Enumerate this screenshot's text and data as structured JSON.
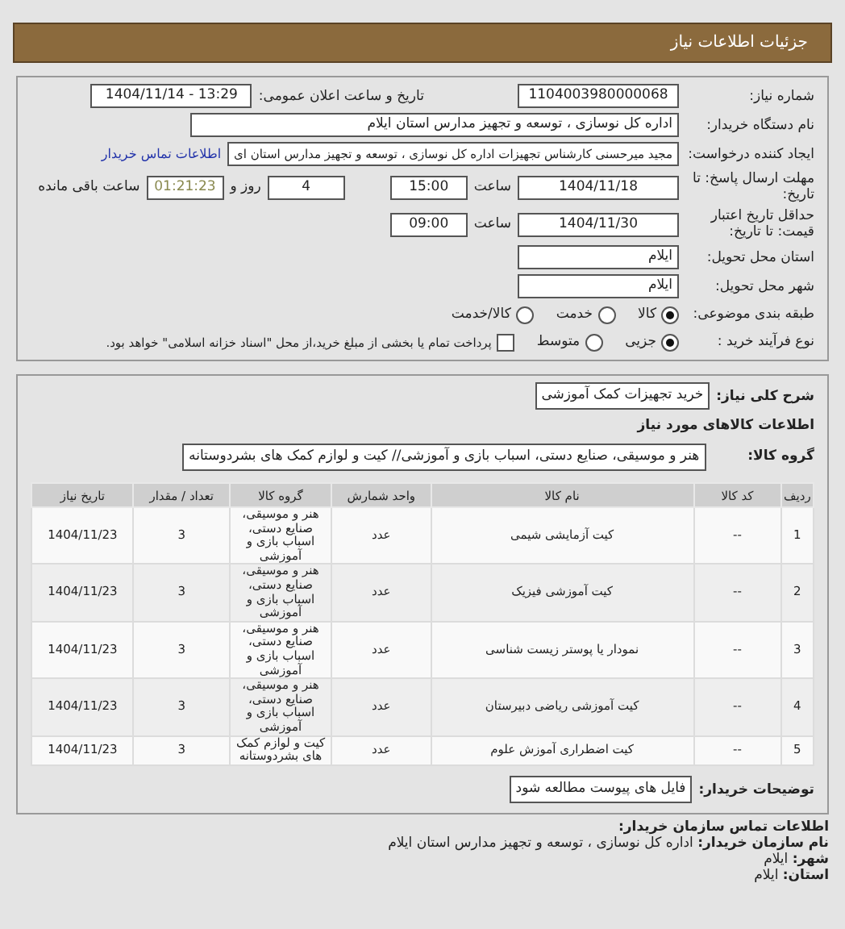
{
  "header": {
    "title": "جزئیات اطلاعات نیاز"
  },
  "details": {
    "need_number_label": "شماره نیاز:",
    "need_number": "1104003980000068",
    "announce_label": "تاریخ و ساعت اعلان عمومی:",
    "announce_value": "1404/11/14 - 13:29",
    "buyer_label": "نام دستگاه خریدار:",
    "buyer": "اداره کل نوسازی ، توسعه و تجهیز مدارس استان ایلام",
    "requester_label": "ایجاد کننده درخواست:",
    "requester": "مجید میرحسنی کارشناس تجهیزات اداره کل نوسازی ، توسعه و تجهیز مدارس استان ای",
    "contact_link": "اطلاعات تماس خریدار",
    "deadline_label": "مهلت ارسال پاسخ: تا تاریخ:",
    "deadline_date": "1404/11/18",
    "time_label": "ساعت",
    "deadline_time": "15:00",
    "days": "4",
    "days_label": "روز و",
    "remaining": "01:21:23",
    "remaining_label": "ساعت باقی مانده",
    "validity_label": "حداقل تاریخ اعتبار قیمت: تا تاریخ:",
    "validity_date": "1404/11/30",
    "validity_time_label": "ساعت",
    "validity_time": "09:00",
    "province_label": "استان محل تحویل:",
    "province": "ایلام",
    "city_label": "شهر محل تحویل:",
    "city": "ایلام",
    "category_label": "طبقه بندی موضوعی:",
    "categories": [
      {
        "label": "کالا",
        "selected": true
      },
      {
        "label": "خدمت",
        "selected": false
      },
      {
        "label": "کالا/خدمت",
        "selected": false
      }
    ],
    "process_label": "نوع فرآیند خرید :",
    "processes": [
      {
        "label": "جزیی",
        "selected": true
      },
      {
        "label": "متوسط",
        "selected": false
      }
    ],
    "treasury": {
      "label": "پرداخت تمام یا بخشی از مبلغ خرید،از محل \"اسناد خزانه اسلامی\" خواهد بود.",
      "checked": false
    }
  },
  "need": {
    "summary_label": "شرح کلی نیاز:",
    "summary": "خرید تجهیزات کمک آموزشی",
    "items_heading": "اطلاعات کالاهای مورد نیاز",
    "group_label": "گروه کالا:",
    "group": "هنر و موسیقی، صنایع دستی، اسباب بازی و آموزشی// کیت و لوازم کمک های بشردوستانه",
    "table": {
      "columns": [
        "ردیف",
        "کد کالا",
        "نام کالا",
        "واحد شمارش",
        "گروه کالا",
        "تعداد / مقدار",
        "تاریخ نیاز"
      ],
      "rows": [
        [
          "1",
          "--",
          "کیت آزمایشی شیمی",
          "عدد",
          "هنر و موسیقی، صنایع دستی، اسباب بازی و آموزشی",
          "3",
          "1404/11/23"
        ],
        [
          "2",
          "--",
          "کیت آموزشی فیزیک",
          "عدد",
          "هنر و موسیقی، صنایع دستی، اسباب بازی و آموزشی",
          "3",
          "1404/11/23"
        ],
        [
          "3",
          "--",
          "نمودار یا پوستر زیست شناسی",
          "عدد",
          "هنر و موسیقی، صنایع دستی، اسباب بازی و آموزشی",
          "3",
          "1404/11/23"
        ],
        [
          "4",
          "--",
          "کیت آموزشی ریاضی دبیرستان",
          "عدد",
          "هنر و موسیقی، صنایع دستی، اسباب بازی و آموزشی",
          "3",
          "1404/11/23"
        ],
        [
          "5",
          "--",
          "کیت اضطراری آموزش علوم",
          "عدد",
          "کیت و لوازم کمک های بشردوستانه",
          "3",
          "1404/11/23"
        ]
      ]
    },
    "notes_label": "توضیحات خریدار:",
    "notes": "فایل های پیوست مطالعه شود"
  },
  "contact": {
    "heading": "اطلاعات تماس سازمان خریدار:",
    "lines": [
      {
        "label": "نام سازمان خریدار:",
        "value": "اداره کل نوسازی ، توسعه و تجهیز مدارس استان ایلام"
      },
      {
        "label": "شهر:",
        "value": "ایلام"
      },
      {
        "label": "استان:",
        "value": "ایلام"
      }
    ]
  }
}
